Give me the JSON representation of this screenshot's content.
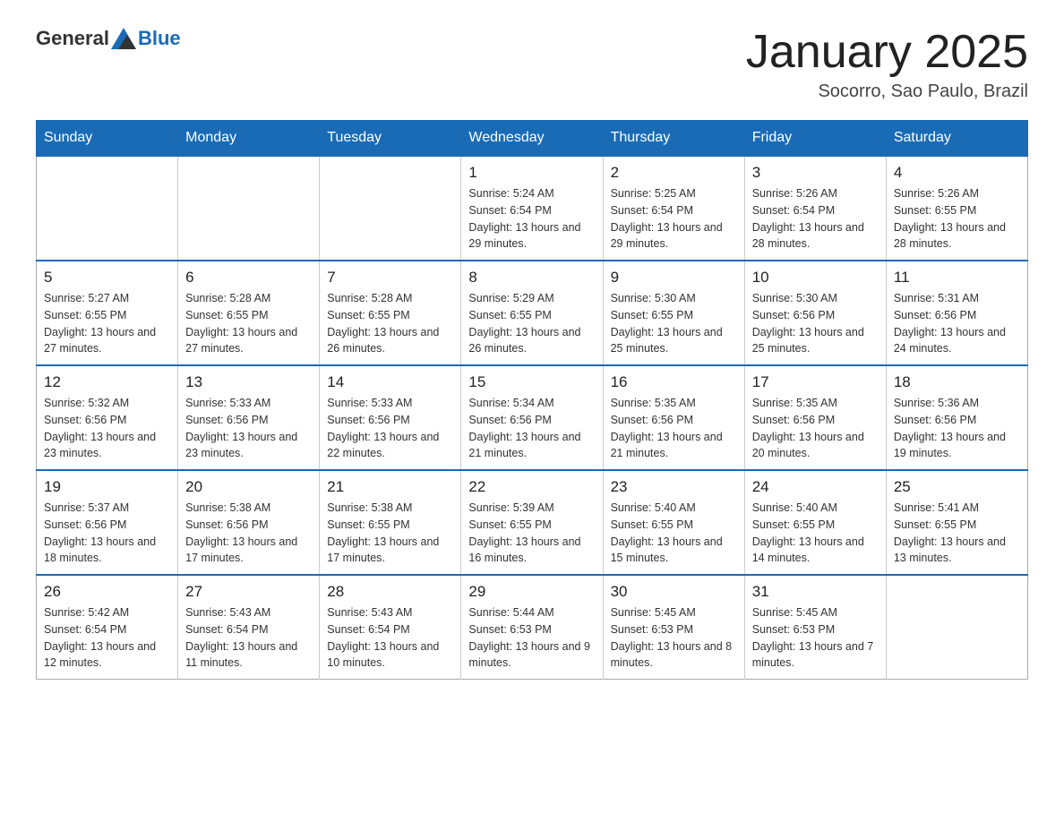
{
  "logo": {
    "general": "General",
    "blue": "Blue"
  },
  "header": {
    "month_title": "January 2025",
    "location": "Socorro, Sao Paulo, Brazil"
  },
  "days_of_week": [
    "Sunday",
    "Monday",
    "Tuesday",
    "Wednesday",
    "Thursday",
    "Friday",
    "Saturday"
  ],
  "weeks": [
    [
      {
        "day": "",
        "info": ""
      },
      {
        "day": "",
        "info": ""
      },
      {
        "day": "",
        "info": ""
      },
      {
        "day": "1",
        "info": "Sunrise: 5:24 AM\nSunset: 6:54 PM\nDaylight: 13 hours and 29 minutes."
      },
      {
        "day": "2",
        "info": "Sunrise: 5:25 AM\nSunset: 6:54 PM\nDaylight: 13 hours and 29 minutes."
      },
      {
        "day": "3",
        "info": "Sunrise: 5:26 AM\nSunset: 6:54 PM\nDaylight: 13 hours and 28 minutes."
      },
      {
        "day": "4",
        "info": "Sunrise: 5:26 AM\nSunset: 6:55 PM\nDaylight: 13 hours and 28 minutes."
      }
    ],
    [
      {
        "day": "5",
        "info": "Sunrise: 5:27 AM\nSunset: 6:55 PM\nDaylight: 13 hours and 27 minutes."
      },
      {
        "day": "6",
        "info": "Sunrise: 5:28 AM\nSunset: 6:55 PM\nDaylight: 13 hours and 27 minutes."
      },
      {
        "day": "7",
        "info": "Sunrise: 5:28 AM\nSunset: 6:55 PM\nDaylight: 13 hours and 26 minutes."
      },
      {
        "day": "8",
        "info": "Sunrise: 5:29 AM\nSunset: 6:55 PM\nDaylight: 13 hours and 26 minutes."
      },
      {
        "day": "9",
        "info": "Sunrise: 5:30 AM\nSunset: 6:55 PM\nDaylight: 13 hours and 25 minutes."
      },
      {
        "day": "10",
        "info": "Sunrise: 5:30 AM\nSunset: 6:56 PM\nDaylight: 13 hours and 25 minutes."
      },
      {
        "day": "11",
        "info": "Sunrise: 5:31 AM\nSunset: 6:56 PM\nDaylight: 13 hours and 24 minutes."
      }
    ],
    [
      {
        "day": "12",
        "info": "Sunrise: 5:32 AM\nSunset: 6:56 PM\nDaylight: 13 hours and 23 minutes."
      },
      {
        "day": "13",
        "info": "Sunrise: 5:33 AM\nSunset: 6:56 PM\nDaylight: 13 hours and 23 minutes."
      },
      {
        "day": "14",
        "info": "Sunrise: 5:33 AM\nSunset: 6:56 PM\nDaylight: 13 hours and 22 minutes."
      },
      {
        "day": "15",
        "info": "Sunrise: 5:34 AM\nSunset: 6:56 PM\nDaylight: 13 hours and 21 minutes."
      },
      {
        "day": "16",
        "info": "Sunrise: 5:35 AM\nSunset: 6:56 PM\nDaylight: 13 hours and 21 minutes."
      },
      {
        "day": "17",
        "info": "Sunrise: 5:35 AM\nSunset: 6:56 PM\nDaylight: 13 hours and 20 minutes."
      },
      {
        "day": "18",
        "info": "Sunrise: 5:36 AM\nSunset: 6:56 PM\nDaylight: 13 hours and 19 minutes."
      }
    ],
    [
      {
        "day": "19",
        "info": "Sunrise: 5:37 AM\nSunset: 6:56 PM\nDaylight: 13 hours and 18 minutes."
      },
      {
        "day": "20",
        "info": "Sunrise: 5:38 AM\nSunset: 6:56 PM\nDaylight: 13 hours and 17 minutes."
      },
      {
        "day": "21",
        "info": "Sunrise: 5:38 AM\nSunset: 6:55 PM\nDaylight: 13 hours and 17 minutes."
      },
      {
        "day": "22",
        "info": "Sunrise: 5:39 AM\nSunset: 6:55 PM\nDaylight: 13 hours and 16 minutes."
      },
      {
        "day": "23",
        "info": "Sunrise: 5:40 AM\nSunset: 6:55 PM\nDaylight: 13 hours and 15 minutes."
      },
      {
        "day": "24",
        "info": "Sunrise: 5:40 AM\nSunset: 6:55 PM\nDaylight: 13 hours and 14 minutes."
      },
      {
        "day": "25",
        "info": "Sunrise: 5:41 AM\nSunset: 6:55 PM\nDaylight: 13 hours and 13 minutes."
      }
    ],
    [
      {
        "day": "26",
        "info": "Sunrise: 5:42 AM\nSunset: 6:54 PM\nDaylight: 13 hours and 12 minutes."
      },
      {
        "day": "27",
        "info": "Sunrise: 5:43 AM\nSunset: 6:54 PM\nDaylight: 13 hours and 11 minutes."
      },
      {
        "day": "28",
        "info": "Sunrise: 5:43 AM\nSunset: 6:54 PM\nDaylight: 13 hours and 10 minutes."
      },
      {
        "day": "29",
        "info": "Sunrise: 5:44 AM\nSunset: 6:53 PM\nDaylight: 13 hours and 9 minutes."
      },
      {
        "day": "30",
        "info": "Sunrise: 5:45 AM\nSunset: 6:53 PM\nDaylight: 13 hours and 8 minutes."
      },
      {
        "day": "31",
        "info": "Sunrise: 5:45 AM\nSunset: 6:53 PM\nDaylight: 13 hours and 7 minutes."
      },
      {
        "day": "",
        "info": ""
      }
    ]
  ]
}
